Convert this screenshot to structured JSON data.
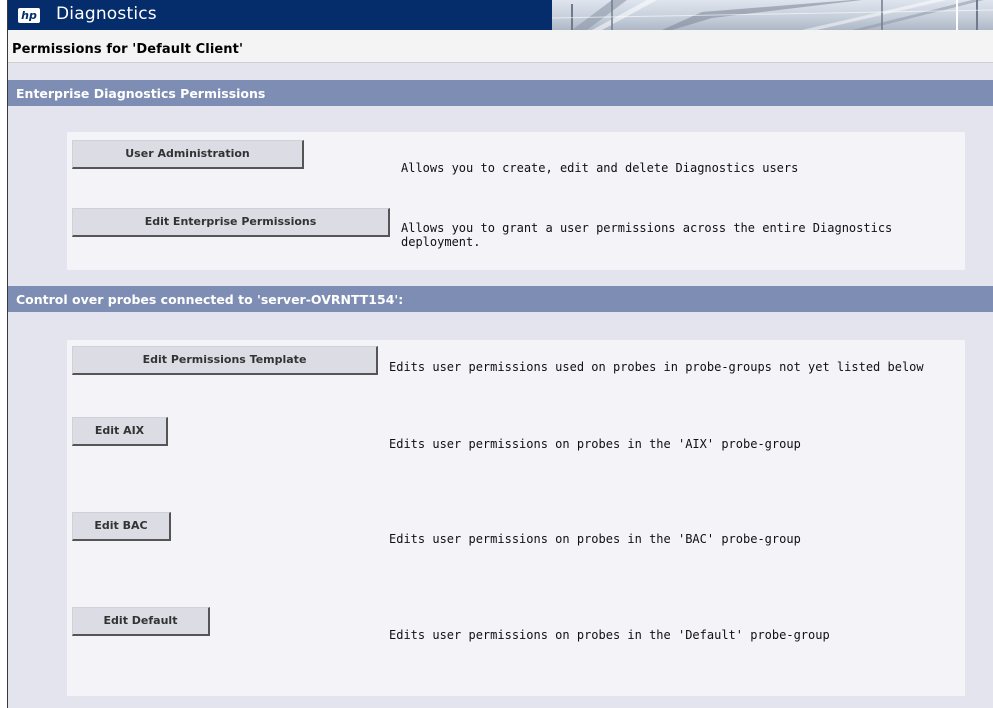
{
  "header": {
    "logo_text": "hp",
    "app_name": "Diagnostics"
  },
  "page_title": "Permissions for 'Default Client'",
  "enterprise_section": {
    "title": "Enterprise Diagnostics Permissions",
    "items": [
      {
        "button": "User Administration",
        "description": "Allows you to create, edit and delete Diagnostics users"
      },
      {
        "button": "Edit Enterprise Permissions",
        "description": "Allows you to grant a user permissions across the entire Diagnostics deployment."
      }
    ]
  },
  "probes_section": {
    "title": "Control over probes connected to 'server-OVRNTT154':",
    "items": [
      {
        "button": "Edit Permissions Template",
        "description": "Edits user permissions used on probes in probe-groups not yet listed below"
      },
      {
        "button": "Edit AIX",
        "description": "Edits user permissions on probes in the 'AIX' probe-group"
      },
      {
        "button": "Edit BAC",
        "description": "Edits user permissions on probes in the 'BAC' probe-group"
      },
      {
        "button": "Edit Default",
        "description": "Edits user permissions on probes in the 'Default' probe-group"
      }
    ]
  },
  "colors": {
    "header_bg": "#052c6b",
    "section_bar": "#7e8db3",
    "page_bg": "#e4e4ef",
    "panel_bg": "#f3f3f8",
    "button_bg": "#dcdce4"
  }
}
